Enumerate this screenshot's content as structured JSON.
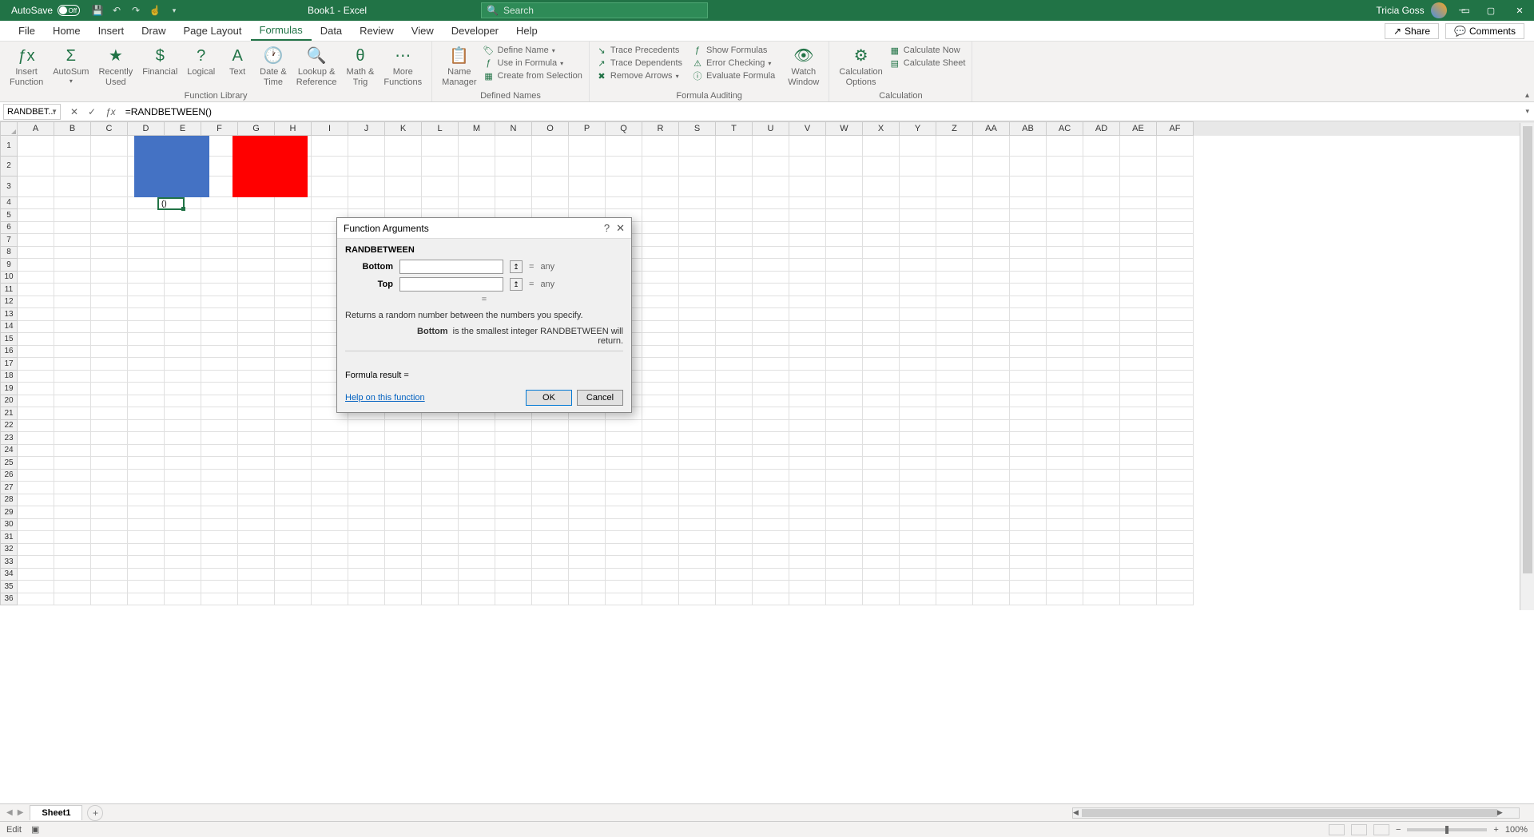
{
  "titlebar": {
    "autosave_label": "AutoSave",
    "autosave_state": "Off",
    "doc_title": "Book1  -  Excel",
    "search_placeholder": "Search",
    "user_name": "Tricia Goss"
  },
  "menu": {
    "tabs": [
      "File",
      "Home",
      "Insert",
      "Draw",
      "Page Layout",
      "Formulas",
      "Data",
      "Review",
      "View",
      "Developer",
      "Help"
    ],
    "active": "Formulas",
    "share": "Share",
    "comments": "Comments"
  },
  "ribbon": {
    "groups": {
      "function_library": {
        "label": "Function Library",
        "insert_function": "Insert\nFunction",
        "autosum": "AutoSum",
        "recently_used": "Recently\nUsed",
        "financial": "Financial",
        "logical": "Logical",
        "text": "Text",
        "date_time": "Date &\nTime",
        "lookup_ref": "Lookup &\nReference",
        "math_trig": "Math &\nTrig",
        "more_functions": "More\nFunctions"
      },
      "defined_names": {
        "label": "Defined Names",
        "name_manager": "Name\nManager",
        "define_name": "Define Name",
        "use_in_formula": "Use in Formula",
        "create_from_selection": "Create from Selection"
      },
      "formula_auditing": {
        "label": "Formula Auditing",
        "trace_precedents": "Trace Precedents",
        "trace_dependents": "Trace Dependents",
        "remove_arrows": "Remove Arrows",
        "show_formulas": "Show Formulas",
        "error_checking": "Error Checking",
        "evaluate_formula": "Evaluate Formula",
        "watch_window": "Watch\nWindow"
      },
      "calculation": {
        "label": "Calculation",
        "calculation_options": "Calculation\nOptions",
        "calculate_now": "Calculate Now",
        "calculate_sheet": "Calculate Sheet"
      }
    }
  },
  "formulabar": {
    "namebox": "RANDBET...",
    "formula": "=RANDBETWEEN()"
  },
  "grid": {
    "columns": [
      "A",
      "B",
      "C",
      "D",
      "E",
      "F",
      "G",
      "H",
      "I",
      "J",
      "K",
      "L",
      "M",
      "N",
      "O",
      "P",
      "Q",
      "R",
      "S",
      "T",
      "U",
      "V",
      "W",
      "X",
      "Y",
      "Z",
      "AA",
      "AB",
      "AC",
      "AD",
      "AE",
      "AF"
    ],
    "visible_rows": 36,
    "active_cell_display": "()"
  },
  "dialog": {
    "title": "Function Arguments",
    "func_name": "RANDBETWEEN",
    "args": {
      "bottom": {
        "label": "Bottom",
        "hint": "any"
      },
      "top": {
        "label": "Top",
        "hint": "any"
      }
    },
    "description": "Returns a random number between the numbers you specify.",
    "param_name": "Bottom",
    "param_desc": "is the smallest integer RANDBETWEEN will return.",
    "result_label": "Formula result =",
    "help_link": "Help on this function",
    "ok": "OK",
    "cancel": "Cancel"
  },
  "sheets": {
    "active": "Sheet1"
  },
  "statusbar": {
    "mode": "Edit",
    "zoom": "100%"
  },
  "colors": {
    "excel_green": "#217346",
    "blue_fill": "#4472c4",
    "red_fill": "#ff0000"
  }
}
